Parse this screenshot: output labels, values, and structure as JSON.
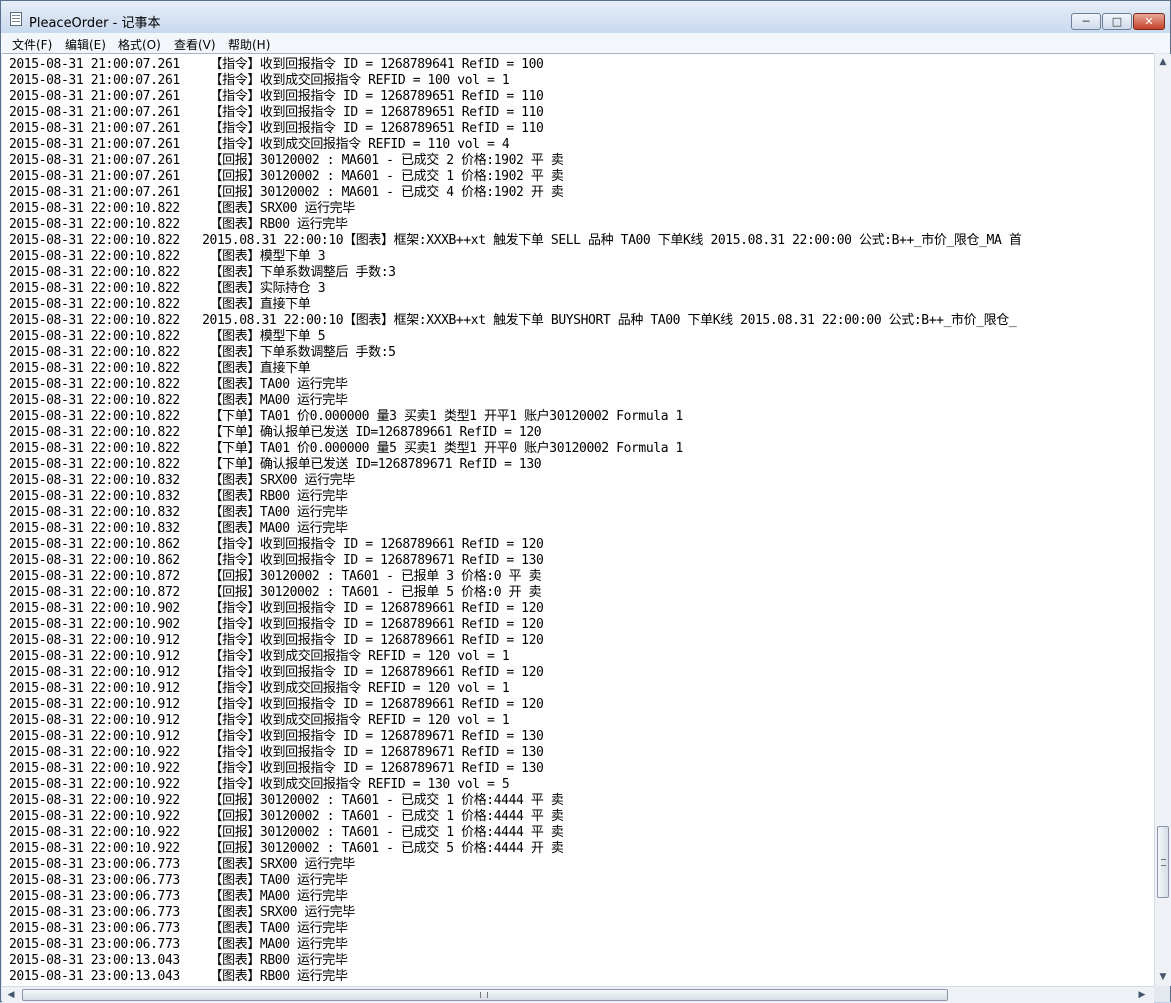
{
  "window": {
    "title": "PleaceOrder - 记事本",
    "controls": {
      "minimize": "─",
      "maximize": "□",
      "close": "✕"
    }
  },
  "menu": [
    "文件(F)",
    "编辑(E)",
    "格式(O)",
    "查看(V)",
    "帮助(H)"
  ],
  "scrollbars": {
    "vertical": {
      "up": "▲",
      "down": "▼"
    },
    "horizontal": {
      "left": "◀",
      "right": "▶"
    }
  },
  "lines": [
    "2015-08-31 21:00:07.261    【指令】收到回报指令 ID = 1268789641 RefID = 100",
    "2015-08-31 21:00:07.261    【指令】收到成交回报指令 REFID = 100 vol = 1",
    "2015-08-31 21:00:07.261    【指令】收到回报指令 ID = 1268789651 RefID = 110",
    "2015-08-31 21:00:07.261    【指令】收到回报指令 ID = 1268789651 RefID = 110",
    "2015-08-31 21:00:07.261    【指令】收到回报指令 ID = 1268789651 RefID = 110",
    "2015-08-31 21:00:07.261    【指令】收到成交回报指令 REFID = 110 vol = 4",
    "2015-08-31 21:00:07.261    【回报】30120002 : MA601 - 已成交 2 价格:1902 平 卖",
    "2015-08-31 21:00:07.261    【回报】30120002 : MA601 - 已成交 1 价格:1902 平 卖",
    "2015-08-31 21:00:07.261    【回报】30120002 : MA601 - 已成交 4 价格:1902 开 卖",
    "2015-08-31 22:00:10.822    【图表】SRX00 运行完毕",
    "2015-08-31 22:00:10.822    【图表】RB00 运行完毕",
    "2015-08-31 22:00:10.822   2015.08.31 22:00:10【图表】框架:XXXB++xt 触发下单 SELL 品种 TA00 下单K线 2015.08.31 22:00:00 公式:B++_市价_限仓_MA 首",
    "2015-08-31 22:00:10.822    【图表】模型下单 3",
    "2015-08-31 22:00:10.822    【图表】下单系数调整后 手数:3",
    "2015-08-31 22:00:10.822    【图表】实际持仓 3",
    "2015-08-31 22:00:10.822    【图表】直接下单",
    "2015-08-31 22:00:10.822   2015.08.31 22:00:10【图表】框架:XXXB++xt 触发下单 BUYSHORT 品种 TA00 下单K线 2015.08.31 22:00:00 公式:B++_市价_限仓_",
    "2015-08-31 22:00:10.822    【图表】模型下单 5",
    "2015-08-31 22:00:10.822    【图表】下单系数调整后 手数:5",
    "2015-08-31 22:00:10.822    【图表】直接下单",
    "2015-08-31 22:00:10.822    【图表】TA00 运行完毕",
    "2015-08-31 22:00:10.822    【图表】MA00 运行完毕",
    "2015-08-31 22:00:10.822    【下单】TA01 价0.000000 量3 买卖1 类型1 开平1 账户30120002 Formula 1",
    "2015-08-31 22:00:10.822    【下单】确认报单已发送 ID=1268789661 RefID = 120",
    "2015-08-31 22:00:10.822    【下单】TA01 价0.000000 量5 买卖1 类型1 开平0 账户30120002 Formula 1",
    "2015-08-31 22:00:10.822    【下单】确认报单已发送 ID=1268789671 RefID = 130",
    "2015-08-31 22:00:10.832    【图表】SRX00 运行完毕",
    "2015-08-31 22:00:10.832    【图表】RB00 运行完毕",
    "2015-08-31 22:00:10.832    【图表】TA00 运行完毕",
    "2015-08-31 22:00:10.832    【图表】MA00 运行完毕",
    "2015-08-31 22:00:10.862    【指令】收到回报指令 ID = 1268789661 RefID = 120",
    "2015-08-31 22:00:10.862    【指令】收到回报指令 ID = 1268789671 RefID = 130",
    "2015-08-31 22:00:10.872    【回报】30120002 : TA601 - 已报单 3 价格:0 平 卖",
    "2015-08-31 22:00:10.872    【回报】30120002 : TA601 - 已报单 5 价格:0 开 卖",
    "2015-08-31 22:00:10.902    【指令】收到回报指令 ID = 1268789661 RefID = 120",
    "2015-08-31 22:00:10.902    【指令】收到回报指令 ID = 1268789661 RefID = 120",
    "2015-08-31 22:00:10.912    【指令】收到回报指令 ID = 1268789661 RefID = 120",
    "2015-08-31 22:00:10.912    【指令】收到成交回报指令 REFID = 120 vol = 1",
    "2015-08-31 22:00:10.912    【指令】收到回报指令 ID = 1268789661 RefID = 120",
    "2015-08-31 22:00:10.912    【指令】收到成交回报指令 REFID = 120 vol = 1",
    "2015-08-31 22:00:10.912    【指令】收到回报指令 ID = 1268789661 RefID = 120",
    "2015-08-31 22:00:10.912    【指令】收到成交回报指令 REFID = 120 vol = 1",
    "2015-08-31 22:00:10.912    【指令】收到回报指令 ID = 1268789671 RefID = 130",
    "2015-08-31 22:00:10.922    【指令】收到回报指令 ID = 1268789671 RefID = 130",
    "2015-08-31 22:00:10.922    【指令】收到回报指令 ID = 1268789671 RefID = 130",
    "2015-08-31 22:00:10.922    【指令】收到成交回报指令 REFID = 130 vol = 5",
    "2015-08-31 22:00:10.922    【回报】30120002 : TA601 - 已成交 1 价格:4444 平 卖",
    "2015-08-31 22:00:10.922    【回报】30120002 : TA601 - 已成交 1 价格:4444 平 卖",
    "2015-08-31 22:00:10.922    【回报】30120002 : TA601 - 已成交 1 价格:4444 平 卖",
    "2015-08-31 22:00:10.922    【回报】30120002 : TA601 - 已成交 5 价格:4444 开 卖",
    "2015-08-31 23:00:06.773    【图表】SRX00 运行完毕",
    "2015-08-31 23:00:06.773    【图表】TA00 运行完毕",
    "2015-08-31 23:00:06.773    【图表】MA00 运行完毕",
    "2015-08-31 23:00:06.773    【图表】SRX00 运行完毕",
    "2015-08-31 23:00:06.773    【图表】TA00 运行完毕",
    "2015-08-31 23:00:06.773    【图表】MA00 运行完毕",
    "2015-08-31 23:00:13.043    【图表】RB00 运行完毕",
    "2015-08-31 23:00:13.043    【图表】RB00 运行完毕"
  ]
}
